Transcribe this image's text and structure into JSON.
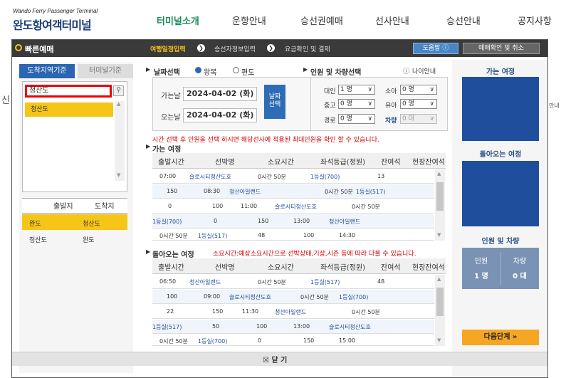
{
  "header": {
    "logo_sub": "Wando Ferry Passenger Terminal",
    "logo_main": "완도항여객터미널",
    "nav": [
      "터미널소개",
      "운항안내",
      "승선권예매",
      "선사안내",
      "승선안내",
      "공지사항"
    ]
  },
  "background": {
    "left_char": "신",
    "right_text": "안내"
  },
  "topbar": {
    "title": "빠른예매",
    "steps": [
      "여행일정입력",
      "승선자정보입력",
      "요금확인 및 결제"
    ],
    "help": "도움말",
    "confirm": "예매확인 및 취소"
  },
  "left": {
    "tabs": [
      "도착지역기준",
      "터미널기준"
    ],
    "search_value": "청산도",
    "suggestion": "청산도",
    "route_headers": [
      "출발지",
      "도착지"
    ],
    "routes": [
      {
        "from": "완도",
        "to": "청산도"
      },
      {
        "from": "청산도",
        "to": "완도"
      }
    ]
  },
  "trip": {
    "section": "날짜선택",
    "options": [
      "왕복",
      "편도"
    ],
    "depart_label": "가는날",
    "return_label": "오는날",
    "depart_date": "2024-04-02 (화)",
    "return_date": "2024-04-02 (화)",
    "date_button": [
      "날짜",
      "선택"
    ]
  },
  "pax": {
    "section": "인원 및 차량선택",
    "age_info": "나이안내",
    "rows": [
      {
        "label": "대인",
        "value": "1 명",
        "label2": "소아",
        "value2": "0 명"
      },
      {
        "label": "중고",
        "value": "0 명",
        "label2": "유아",
        "value2": "0 명"
      },
      {
        "label": "경로",
        "value": "0 명",
        "label2": "차량",
        "value2": "0 대"
      }
    ]
  },
  "notice": "시간 선택 후 인원을 선택 하시면 해당선사에 적용된 최대인원을 확인 할 수 있습니다.",
  "go": {
    "label": "가는 여정",
    "headers": [
      "출발시간",
      "선박명",
      "소요시간",
      "좌석등급(정원)",
      "잔여석",
      "현장잔여석"
    ],
    "rows": [
      [
        "07:00",
        "슬로시티청산도호",
        "0시간 50분",
        "1등실(700)",
        "13",
        ""
      ],
      [
        "150",
        "08:30",
        "청산아일랜드",
        "0시간 50분",
        "1등실(517)",
        ""
      ],
      [
        "0",
        "100",
        "11:00",
        "슬로시티청산도호",
        "0시간 50분",
        ""
      ],
      [
        "1등실(700)",
        "0",
        "150",
        "13:00",
        "청산아일랜드",
        ""
      ],
      [
        "0시간 50분",
        "1등실(517)",
        "48",
        "100",
        "14:30",
        ""
      ]
    ]
  },
  "ret": {
    "label": "돌아오는 여정",
    "note": "소요시간:예상소요시간으로 선박상태,기상,시즌 등에 따라 다를 수 있습니다.",
    "headers": [
      "출발시간",
      "선박명",
      "소요시간",
      "좌석등급(정원)",
      "잔여석",
      "현장잔여석"
    ],
    "rows": [
      [
        "06:50",
        "청산아일랜드",
        "0시간 50분",
        "1등실(517)",
        "48",
        ""
      ],
      [
        "100",
        "09:00",
        "슬로시티청산도호",
        "0시간 50분",
        "1등실(700)",
        ""
      ],
      [
        "22",
        "150",
        "11:30",
        "청산아일랜드",
        "0시간 50분",
        ""
      ],
      [
        "1등실(517)",
        "50",
        "100",
        "13:00",
        "슬로시티청산도호",
        ""
      ],
      [
        "0시간 50분",
        "1등실(700)",
        "0",
        "150",
        "15:00",
        ""
      ]
    ]
  },
  "right": {
    "go_title": "가는 여정",
    "ret_title": "돌아오는 여정",
    "sum_title": "인원 및 차량",
    "sum_labels": [
      "인원",
      "차량"
    ],
    "sum_values": [
      "1 명",
      "0 대"
    ],
    "next": "다음단계 »"
  },
  "close": "닫 기",
  "colors": {
    "accent": "#2b66b2",
    "highlight": "#f5c518",
    "alert": "#d60000",
    "next": "#f5a623"
  }
}
